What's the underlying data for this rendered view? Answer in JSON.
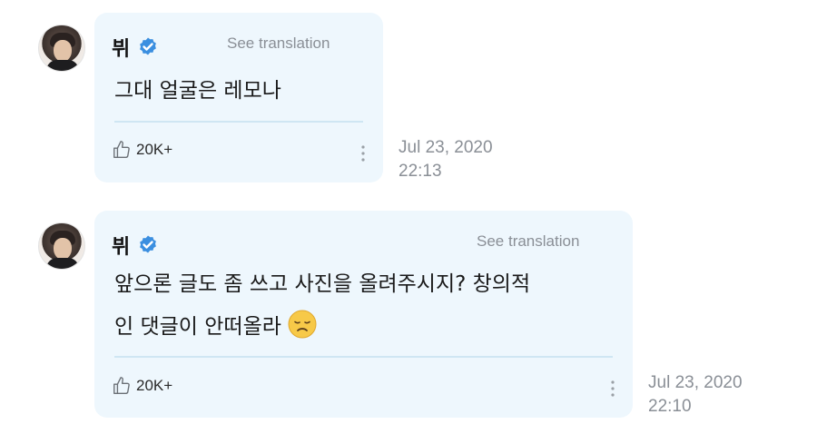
{
  "comments": [
    {
      "author": "뷔",
      "see_translation": "See translation",
      "text": "그대 얼굴은 레모나",
      "likes": "20K+",
      "date": "Jul 23, 2020",
      "time": "22:13"
    },
    {
      "author": "뷔",
      "see_translation": "See translation",
      "text_line1": "앞으론 글도 좀 쓰고 사진을 올려주시지? 창의적",
      "text_line2": "인 댓글이 안떠올라",
      "emoji": "😞",
      "likes": "20K+",
      "date": "Jul 23, 2020",
      "time": "22:10"
    }
  ],
  "colors": {
    "bubble": "#eef7fd",
    "verified": "#3b8fe0",
    "muted": "#8a8f96",
    "divider": "#cfe6f3"
  },
  "icons": [
    "verified-badge-icon",
    "thumbs-up-icon",
    "more-vertical-icon",
    "disappointed-face-emoji"
  ]
}
